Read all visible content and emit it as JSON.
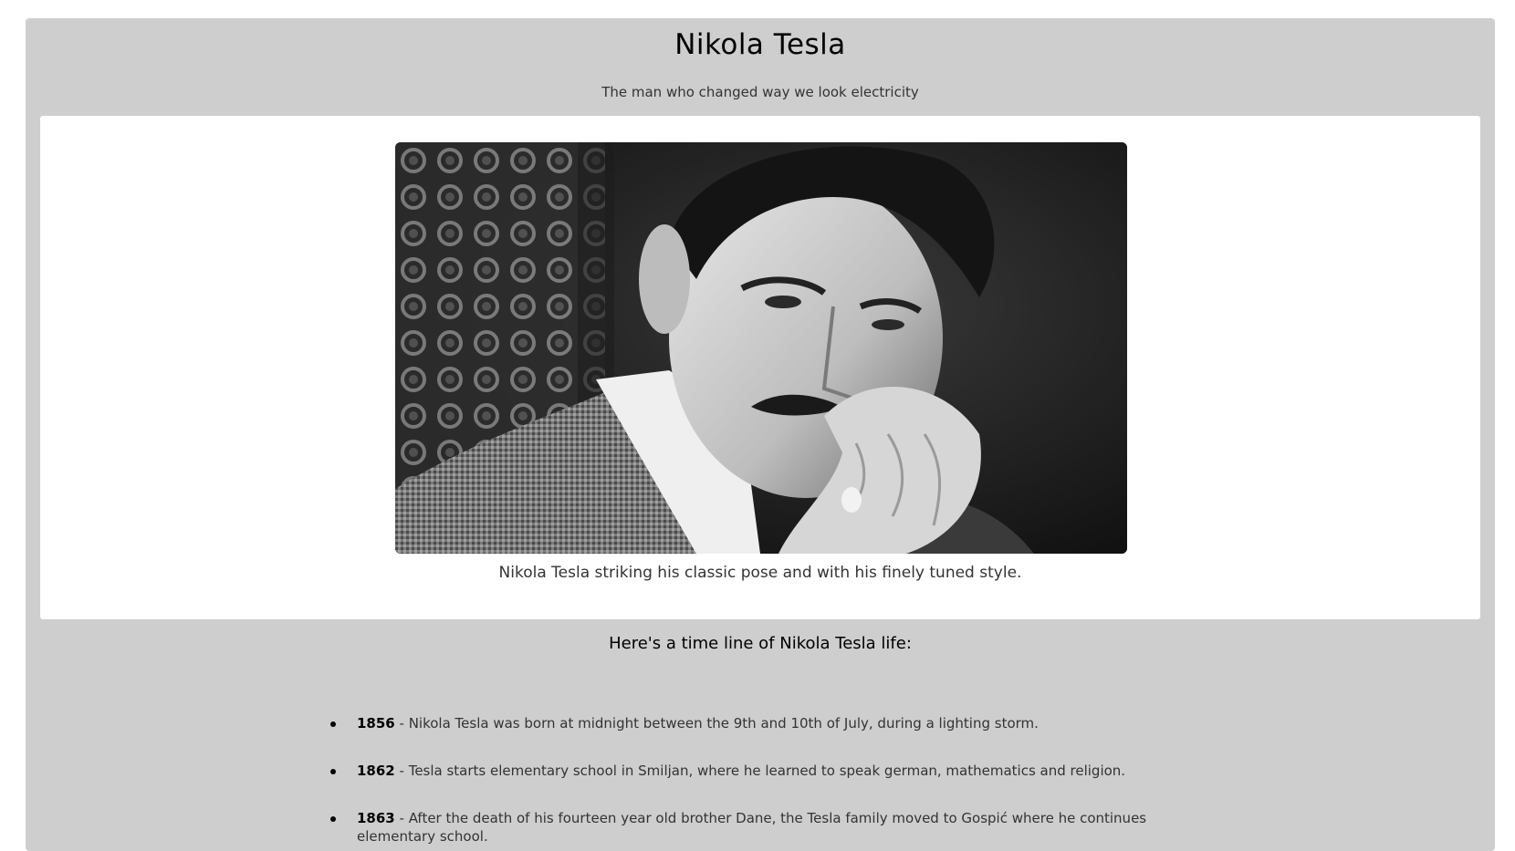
{
  "header": {
    "title": "Nikola Tesla",
    "subtitle": "The man who changed way we look electricity"
  },
  "figure": {
    "caption": "Nikola Tesla striking his classic pose and with his finely tuned style."
  },
  "timeline": {
    "heading": "Here's a time line of Nikola Tesla life:",
    "items": [
      {
        "year": "1856",
        "text": " - Nikola Tesla was born at midnight between the 9th and 10th of July, during a lighting storm."
      },
      {
        "year": "1862",
        "text": " - Tesla starts elementary school in Smiljan, where he learned to speak german, mathematics and religion."
      },
      {
        "year": "1863",
        "text": " - After the death of his fourteen year old brother Dane, the Tesla family moved to Gospić where he continues elementary school."
      }
    ]
  },
  "colors": {
    "page_background": "#cecece",
    "card_background": "#ffffff"
  }
}
